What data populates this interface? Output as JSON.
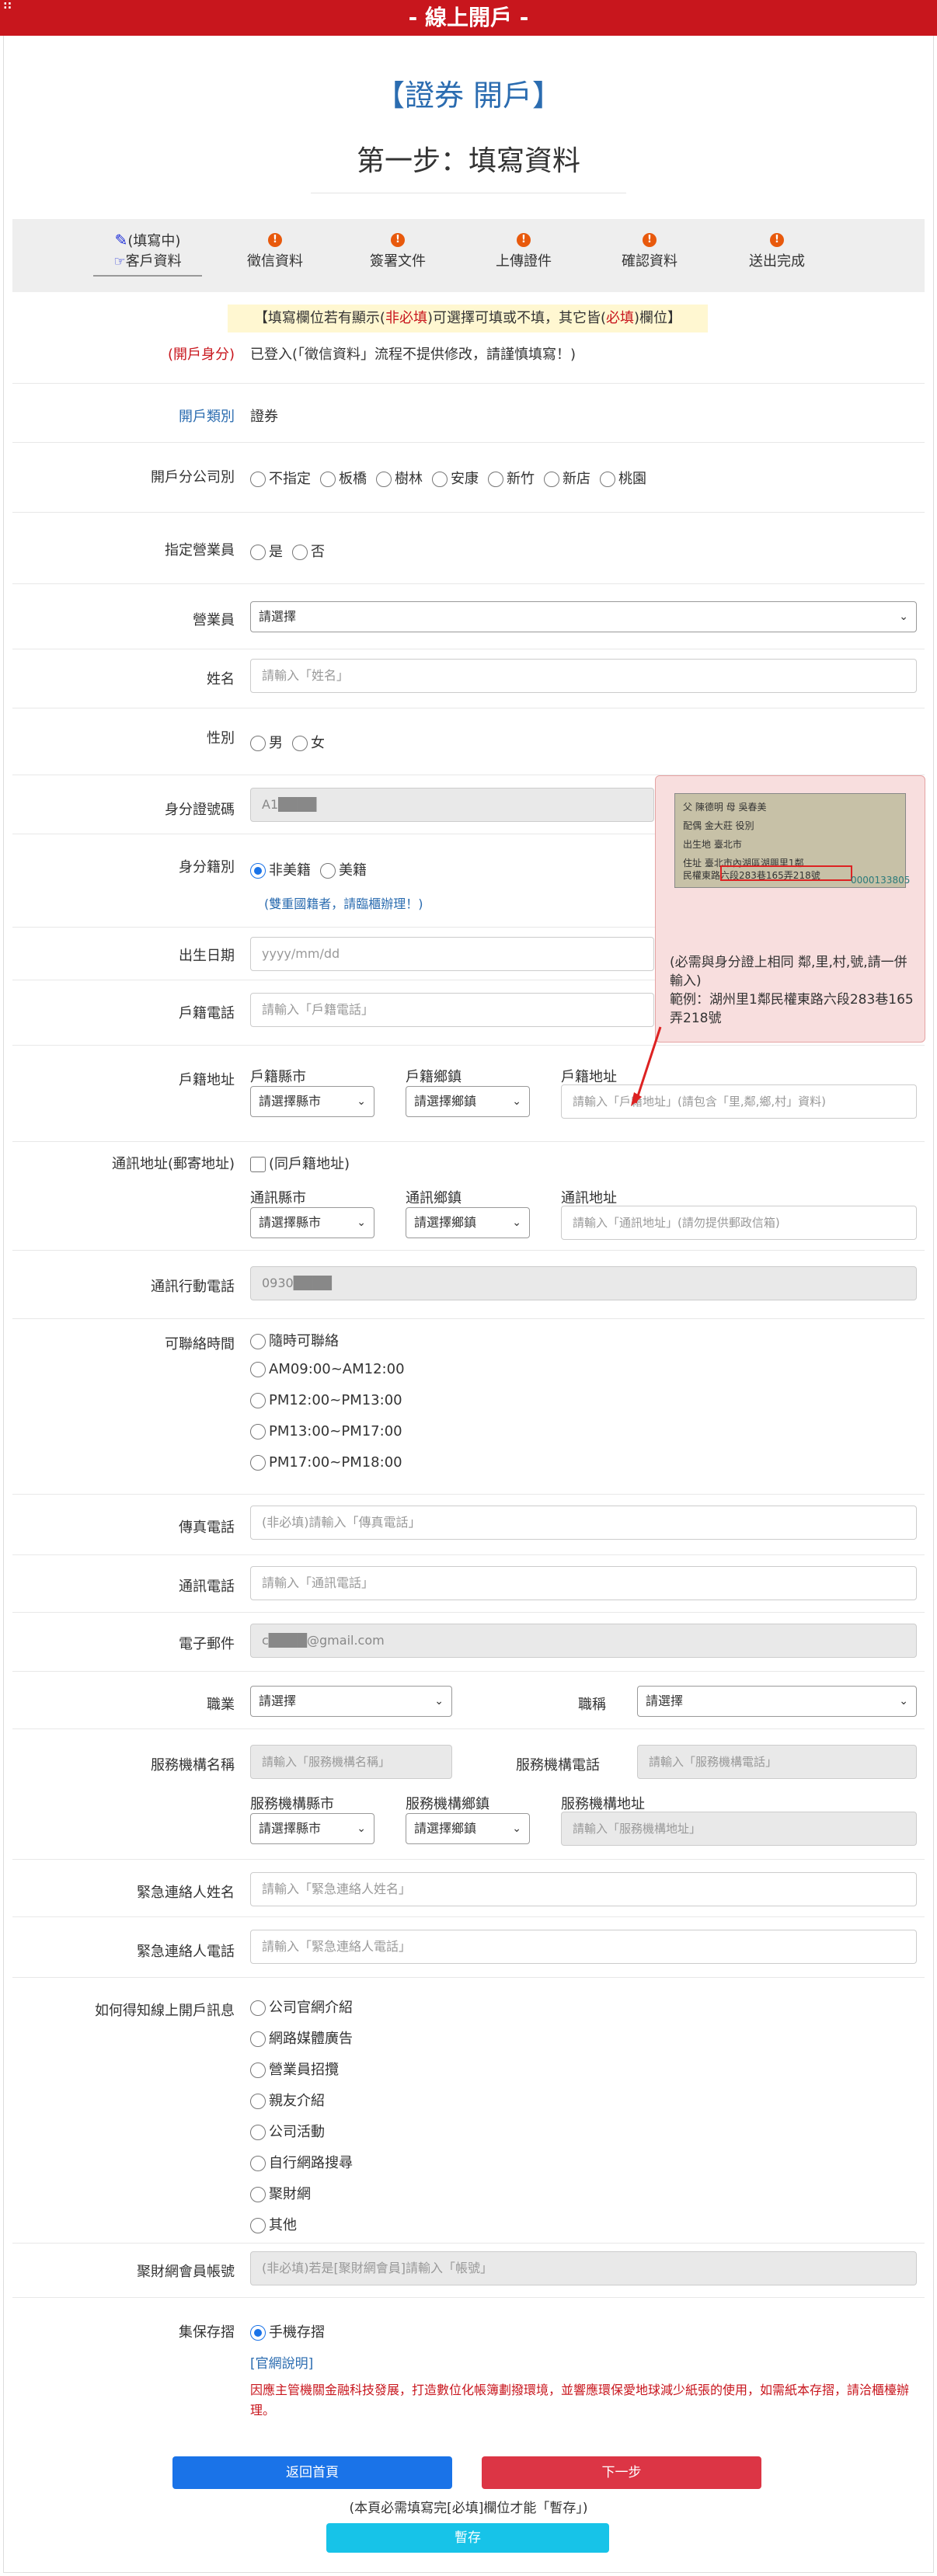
{
  "app": {
    "title": "- 線上開戶 -",
    "dots": "::"
  },
  "page": {
    "heading": "【證券 開戶】",
    "step_title": "第一步：填寫資料"
  },
  "tabs": [
    {
      "status": "(填寫中)",
      "label": "客戶資料"
    },
    {
      "label": "徵信資料"
    },
    {
      "label": "簽署文件"
    },
    {
      "label": "上傳證件"
    },
    {
      "label": "確認資料"
    },
    {
      "label": "送出完成"
    }
  ],
  "notice": {
    "part1": "【填寫欄位若有顯示(",
    "red1": "非必填",
    "part2": ")可選擇可填或不填，其它皆(",
    "red2": "必填",
    "part3": ")欄位】"
  },
  "account_identity": {
    "label": "(開戶身分)",
    "value": "已登入(「徵信資料」流程不提供修改，請謹慎填寫！)"
  },
  "account_type": {
    "label": "開戶類別",
    "value": "證券"
  },
  "branch": {
    "label": "開戶分公司別",
    "options": [
      "不指定",
      "板橋",
      "樹林",
      "安康",
      "新竹",
      "新店",
      "桃園"
    ]
  },
  "designated_agent": {
    "label": "指定營業員",
    "options": [
      "是",
      "否"
    ]
  },
  "agent": {
    "label": "營業員",
    "value": "請選擇"
  },
  "name": {
    "label": "姓名",
    "placeholder": "請輸入「姓名」"
  },
  "gender": {
    "label": "性別",
    "options": [
      "男",
      "女"
    ]
  },
  "id_number": {
    "label": "身分證號碼",
    "value": "A1████"
  },
  "nationality": {
    "label": "身分籍別",
    "options": [
      "非美籍",
      "美籍"
    ],
    "hint": "(雙重國籍者，請臨櫃辦理！)"
  },
  "birth": {
    "label": "出生日期",
    "placeholder": "yyyy/mm/dd"
  },
  "household_phone": {
    "label": "戶籍電話",
    "placeholder": "請輸入「戶籍電話」"
  },
  "household_address": {
    "label": "戶籍地址",
    "county_label": "戶籍縣市",
    "county_value": "請選擇縣市",
    "town_label": "戶籍鄉鎮",
    "town_value": "請選擇鄉鎮",
    "addr_label": "戶籍地址",
    "addr_placeholder": "請輸入「戶籍地址」(請包含「里,鄰,鄉,村」資料)"
  },
  "tooltip": {
    "card_lines": [
      "父  陳德明    母 吳春美",
      "配偶  金大莊    役別",
      "出生地  臺北市",
      "住址  臺北市內湖區湖興里1鄰",
      "       民權東路六段283巷165弄218號"
    ],
    "card_no": "0000133805",
    "text1": "(必需與身分證上相同 鄰,里,村,號,請一併輸入)",
    "text2": "範例：湖州里1鄰民權東路六段283巷165弄218號"
  },
  "mailing_address": {
    "label": "通訊地址(郵寄地址)",
    "same_label": "(同戶籍地址)",
    "county_label": "通訊縣市",
    "county_value": "請選擇縣市",
    "town_label": "通訊鄉鎮",
    "town_value": "請選擇鄉鎮",
    "addr_label": "通訊地址",
    "addr_placeholder": "請輸入「通訊地址」(請勿提供郵政信箱)"
  },
  "mobile": {
    "label": "通訊行動電話",
    "value": "0930████"
  },
  "contact_time": {
    "label": "可聯絡時間",
    "options": [
      "隨時可聯絡",
      "AM09:00~AM12:00",
      "PM12:00~PM13:00",
      "PM13:00~PM17:00",
      "PM17:00~PM18:00"
    ]
  },
  "fax": {
    "label": "傳真電話",
    "placeholder": "(非必填)請輸入「傳真電話」"
  },
  "contact_phone": {
    "label": "通訊電話",
    "placeholder": "請輸入「通訊電話」"
  },
  "email": {
    "label": "電子郵件",
    "value": "c████@gmail.com"
  },
  "job": {
    "label": "職業",
    "value": "請選擇",
    "title_label": "職稱",
    "title_value": "請選擇"
  },
  "company": {
    "name_label": "服務機構名稱",
    "name_placeholder": "請輸入「服務機構名稱」",
    "phone_label": "服務機構電話",
    "phone_placeholder": "請輸入「服務機構電話」",
    "county_label": "服務機構縣市",
    "county_value": "請選擇縣市",
    "town_label": "服務機構鄉鎮",
    "town_value": "請選擇鄉鎮",
    "addr_label": "服務機構地址",
    "addr_placeholder": "請輸入「服務機構地址」"
  },
  "emergency_name": {
    "label": "緊急連絡人姓名",
    "placeholder": "請輸入「緊急連絡人姓名」"
  },
  "emergency_phone": {
    "label": "緊急連絡人電話",
    "placeholder": "請輸入「緊急連絡人電話」"
  },
  "source": {
    "label": "如何得知線上開戶訊息",
    "options": [
      "公司官網介紹",
      "網路媒體廣告",
      "營業員招攬",
      "親友介紹",
      "公司活動",
      "自行網路搜尋",
      "聚財網",
      "其他"
    ]
  },
  "jucai_account": {
    "label": "聚財網會員帳號",
    "placeholder": "(非必填)若是[聚財網會員]請輸入「帳號」"
  },
  "custody": {
    "label": "集保存摺",
    "option": "手機存摺",
    "link": "[官網說明]",
    "note": "因應主管機關金融科技發展，打造數位化帳簿劃撥環境，並響應環保愛地球減少紙張的使用，如需紙本存摺，請洽櫃檯辦理。"
  },
  "buttons": {
    "home": "返回首頁",
    "next": "下一步",
    "save_note": "(本頁必需填寫完[必填]欄位才能「暫存」)",
    "save": "暫存"
  },
  "colors": {
    "brand_red": "#c8161d",
    "primary_blue": "#1a73e8",
    "danger": "#dc3545",
    "info": "#17c3e8"
  }
}
